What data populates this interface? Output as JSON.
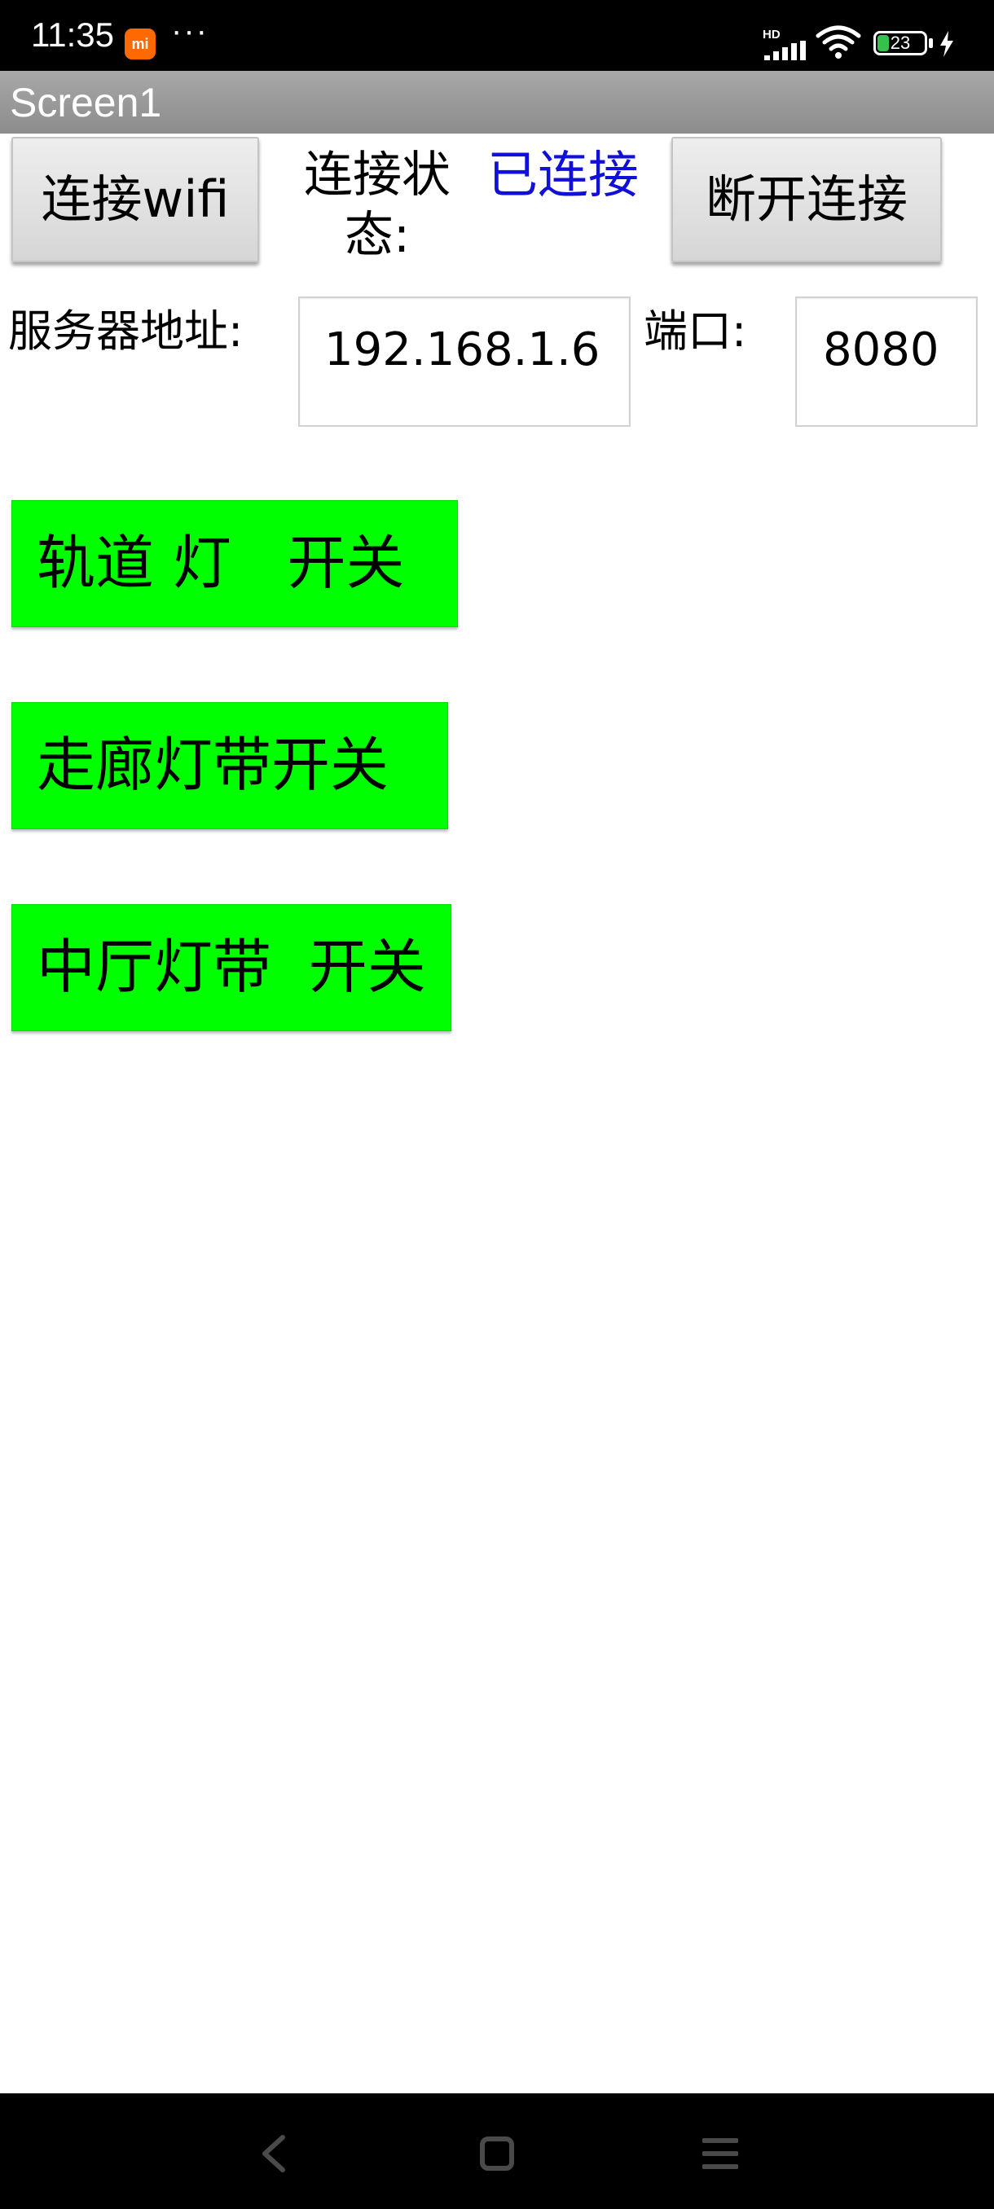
{
  "status_bar": {
    "time": "11:35",
    "notification_dots": "···",
    "mi_badge": "mi",
    "network_type": "HD",
    "battery_level": "23",
    "icons": [
      "mi-app-icon",
      "signal-icon",
      "wifi-icon",
      "battery-icon",
      "charging-icon"
    ]
  },
  "title_bar": {
    "title": "Screen1"
  },
  "connection": {
    "connect_wifi_label": "连接wifi",
    "status_label": "连接状态:",
    "status_value": "已连接",
    "disconnect_label": "断开连接"
  },
  "server": {
    "address_label": "服务器地址:",
    "address_value": "192.168.1.6",
    "port_label": "端口:",
    "port_value": "8080"
  },
  "light_buttons": [
    {
      "label": "轨道 灯   开关"
    },
    {
      "label": "走廊灯带开关"
    },
    {
      "label": "中厅灯带  开关"
    }
  ],
  "colors": {
    "status_bar_bg": "#000000",
    "title_bar_bg": "#999999",
    "status_value_color": "#1010d8",
    "switch_button_bg": "#00ff00",
    "grey_button_bg": "#e0e0e0",
    "battery_fill": "#36c24a",
    "mi_badge_bg": "#ff6900"
  },
  "nav_bar": {
    "icons": [
      "back-icon",
      "home-icon",
      "menu-icon"
    ]
  }
}
